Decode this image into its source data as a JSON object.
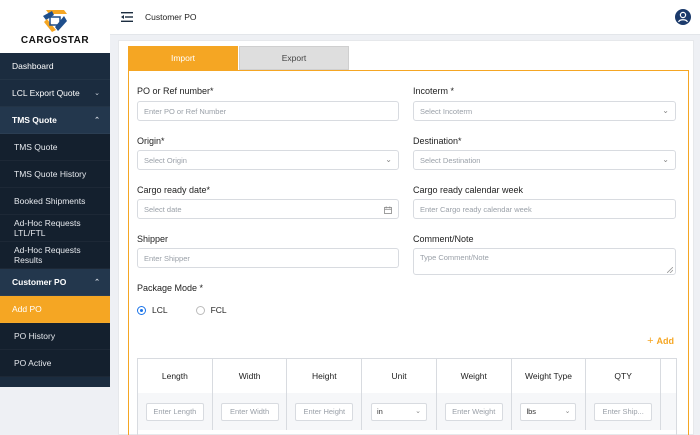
{
  "brand": {
    "name": "CARGOSTAR"
  },
  "sidebar": {
    "items": [
      {
        "label": "Dashboard",
        "type": "item",
        "chevron": ""
      },
      {
        "label": "LCL Export Quote",
        "type": "item",
        "chevron": "chevron-down"
      },
      {
        "label": "TMS Quote",
        "type": "section",
        "chevron": "chevron-up"
      },
      {
        "label": "TMS Quote",
        "type": "sub",
        "chevron": ""
      },
      {
        "label": "TMS Quote History",
        "type": "sub",
        "chevron": ""
      },
      {
        "label": "Booked Shipments",
        "type": "sub",
        "chevron": ""
      },
      {
        "label": "Ad-Hoc Requests LTL/FTL",
        "type": "sub",
        "chevron": ""
      },
      {
        "label": "Ad-Hoc Requests Results",
        "type": "sub",
        "chevron": ""
      },
      {
        "label": "Customer PO",
        "type": "section",
        "chevron": "chevron-up"
      },
      {
        "label": "Add PO",
        "type": "active",
        "chevron": ""
      },
      {
        "label": "PO History",
        "type": "sub",
        "chevron": ""
      },
      {
        "label": "PO Active",
        "type": "sub",
        "chevron": ""
      }
    ]
  },
  "header": {
    "title": "Customer PO"
  },
  "tabs": {
    "import": "Import",
    "export": "Export"
  },
  "form": {
    "po_ref": {
      "label": "PO or Ref number*",
      "placeholder": "Enter PO or Ref Number"
    },
    "incoterm": {
      "label": "Incoterm *",
      "placeholder": "Select Incoterm"
    },
    "origin": {
      "label": "Origin*",
      "placeholder": "Select Origin"
    },
    "destination": {
      "label": "Destination*",
      "placeholder": "Select Destination"
    },
    "cargo_ready_date": {
      "label": "Cargo ready date*",
      "placeholder": "Select date"
    },
    "cargo_ready_week": {
      "label": "Cargo ready calendar week",
      "placeholder": "Enter Cargo ready calendar week"
    },
    "shipper": {
      "label": "Shipper",
      "placeholder": "Enter Shipper"
    },
    "comment": {
      "label": "Comment/Note",
      "placeholder": "Type Comment/Note"
    },
    "package_mode": {
      "label": "Package Mode *",
      "options": [
        "LCL",
        "FCL"
      ],
      "selected": "LCL"
    }
  },
  "add_label": "Add",
  "table": {
    "headers": [
      "Length",
      "Width",
      "Height",
      "Unit",
      "Weight",
      "Weight Type",
      "QTY"
    ],
    "row": {
      "length": "Enter Length",
      "width": "Enter Width",
      "height": "Enter Height",
      "unit": "in",
      "weight": "Enter Weight",
      "weight_type": "lbs",
      "qty": "Enter Ship..."
    }
  },
  "colors": {
    "accent": "#f5a623",
    "sidebar": "#1b2c3f",
    "radio": "#1a73e8"
  }
}
